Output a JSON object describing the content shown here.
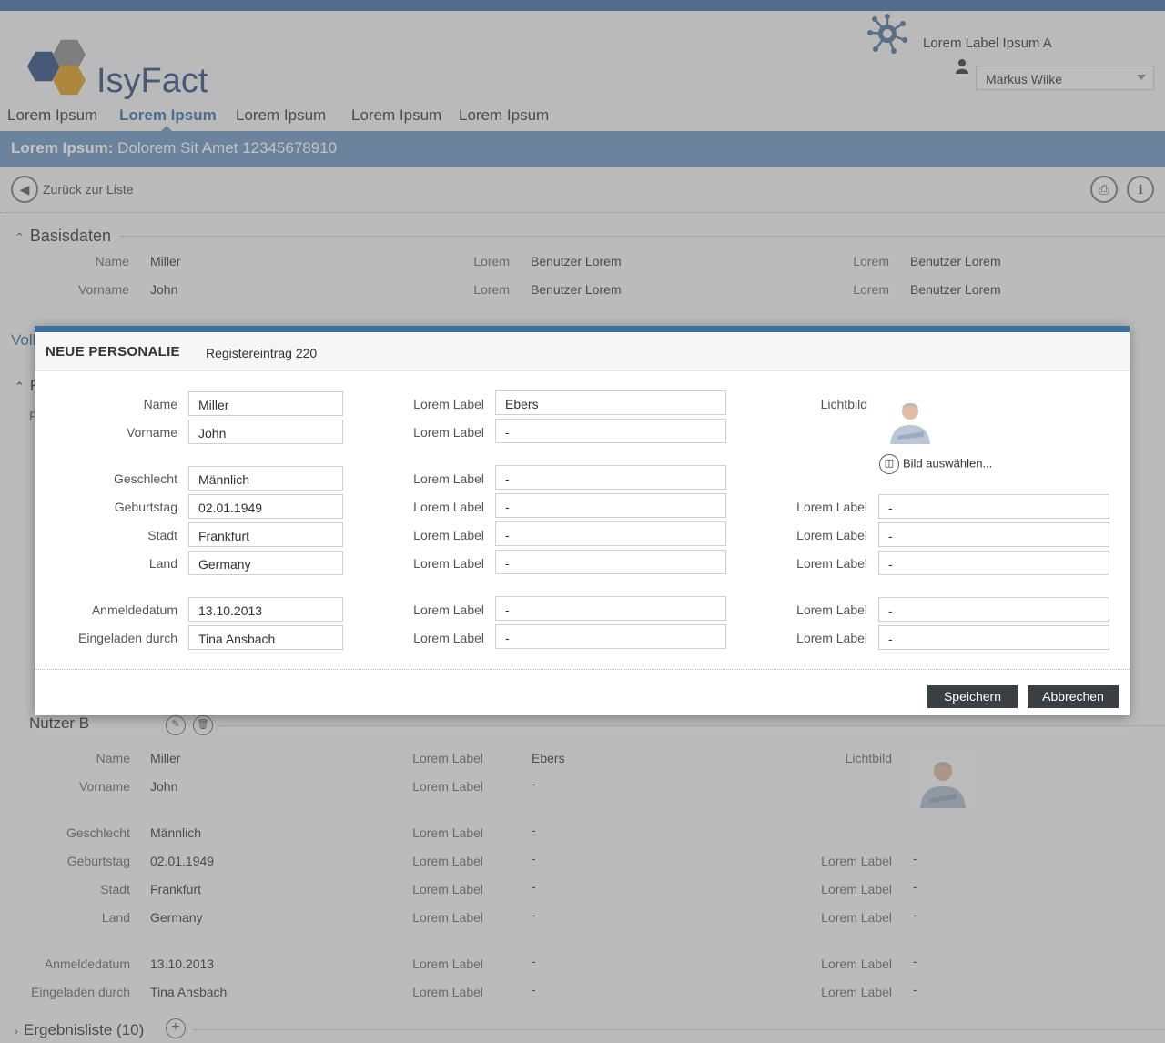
{
  "app": {
    "logo_text": "IsyFact",
    "label": "Lorem Label Ipsum A",
    "user": "Markus Wilke",
    "icons": {
      "app": "network-icon",
      "user": "user-icon"
    }
  },
  "nav": {
    "tabs": [
      "Lorem Ipsum",
      "Lorem Ipsum",
      "Lorem Ipsum",
      "Lorem Ipsum",
      "Lorem Ipsum"
    ],
    "active_index": 1
  },
  "page_title": {
    "bold": "Lorem Ipsum:",
    "rest": " Dolorem Sit Amet 12345678910"
  },
  "toolbar": {
    "back_label": "Zurück zur Liste",
    "icons": [
      "print-icon",
      "info-icon"
    ]
  },
  "basisdaten": {
    "title": "Basisdaten",
    "rows": [
      {
        "l1": "Name",
        "v1": "Miller",
        "l2": "Lorem",
        "v2": "Benutzer Lorem",
        "l3": "Lorem",
        "v3": "Benutzer Lorem"
      },
      {
        "l1": "Vorname",
        "v1": "John",
        "l2": "Lorem",
        "v2": "Benutzer Lorem",
        "l3": "Lorem",
        "v3": "Benutzer Lorem"
      }
    ]
  },
  "partial": {
    "tab_fragment": "Voll",
    "section_fragment": "F",
    "row_fragment": "F"
  },
  "nutzer_b": {
    "title": "Nutzer B",
    "photo_label": "Lichtbild",
    "col1": [
      {
        "label": "Name",
        "value": "Miller"
      },
      {
        "label": "Vorname",
        "value": "John"
      },
      {
        "label": "Geschlecht",
        "value": "Männlich"
      },
      {
        "label": "Geburtstag",
        "value": "02.01.1949"
      },
      {
        "label": "Stadt",
        "value": "Frankfurt"
      },
      {
        "label": "Land",
        "value": "Germany"
      },
      {
        "label": "Anmeldedatum",
        "value": "13.10.2013"
      },
      {
        "label": "Eingeladen durch",
        "value": "Tina Ansbach"
      }
    ],
    "col2": [
      {
        "label": "Lorem Label",
        "value": "Ebers"
      },
      {
        "label": "Lorem Label",
        "value": "-"
      },
      {
        "label": "Lorem Label",
        "value": "-"
      },
      {
        "label": "Lorem Label",
        "value": "-"
      },
      {
        "label": "Lorem Label",
        "value": "-"
      },
      {
        "label": "Lorem Label",
        "value": "-"
      },
      {
        "label": "Lorem Label",
        "value": "-"
      },
      {
        "label": "Lorem Label",
        "value": "-"
      }
    ],
    "col3": [
      {
        "label": "Lorem Label",
        "value": "-"
      },
      {
        "label": "Lorem Label",
        "value": "-"
      },
      {
        "label": "Lorem Label",
        "value": "-"
      },
      {
        "label": "Lorem Label",
        "value": "-"
      },
      {
        "label": "Lorem Label",
        "value": "-"
      }
    ]
  },
  "ergebnisliste": {
    "title": "Ergebnisliste (10)"
  },
  "dialog": {
    "title": "NEUE PERSONALIE",
    "subtitle": "Registereintrag 220",
    "photo_label": "Lichtbild",
    "bild_button": "Bild auswählen...",
    "col1": [
      {
        "label": "Name",
        "value": "Miller"
      },
      {
        "label": "Vorname",
        "value": "John"
      },
      {
        "label": "Geschlecht",
        "value": "Männlich"
      },
      {
        "label": "Geburtstag",
        "value": "02.01.1949"
      },
      {
        "label": "Stadt",
        "value": "Frankfurt"
      },
      {
        "label": "Land",
        "value": "Germany"
      },
      {
        "label": "Anmeldedatum",
        "value": "13.10.2013"
      },
      {
        "label": "Eingeladen durch",
        "value": "Tina Ansbach"
      }
    ],
    "col2": [
      {
        "label": "Lorem Label",
        "value": "Ebers"
      },
      {
        "label": "Lorem Label",
        "value": "-"
      },
      {
        "label": "Lorem Label",
        "value": "-"
      },
      {
        "label": "Lorem Label",
        "value": "-"
      },
      {
        "label": "Lorem Label",
        "value": "-"
      },
      {
        "label": "Lorem Label",
        "value": "-"
      },
      {
        "label": "Lorem Label",
        "value": "-"
      },
      {
        "label": "Lorem Label",
        "value": "-"
      }
    ],
    "col3": [
      {
        "label": "Lorem Label",
        "value": "-"
      },
      {
        "label": "Lorem Label",
        "value": "-"
      },
      {
        "label": "Lorem Label",
        "value": "-"
      },
      {
        "label": "Lorem Label",
        "value": "-"
      },
      {
        "label": "Lorem Label",
        "value": "-"
      }
    ],
    "save": "Speichern",
    "cancel": "Abbrechen"
  },
  "colors": {
    "accent": "#3c6fa2",
    "titlebar": "#6a93be",
    "button": "#3b3f44",
    "hex_blue": "#2c4b7c",
    "hex_orange": "#d99a1b",
    "hex_grey": "#8a8a8a"
  }
}
